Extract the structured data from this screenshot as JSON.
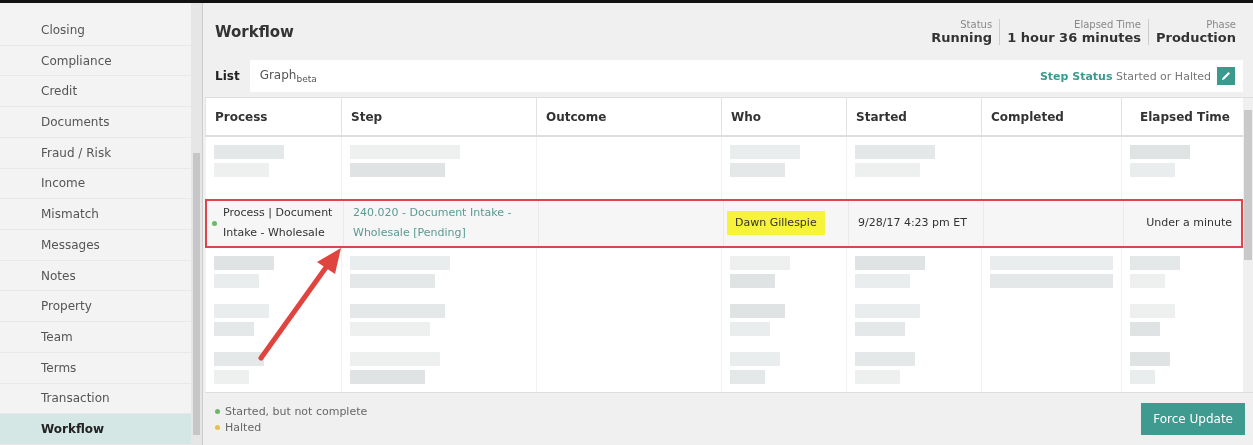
{
  "sidebar": {
    "items": [
      {
        "label": "Closing",
        "selected": false
      },
      {
        "label": "Compliance",
        "selected": false
      },
      {
        "label": "Credit",
        "selected": false
      },
      {
        "label": "Documents",
        "selected": false
      },
      {
        "label": "Fraud / Risk",
        "selected": false
      },
      {
        "label": "Income",
        "selected": false
      },
      {
        "label": "Mismatch",
        "selected": false
      },
      {
        "label": "Messages",
        "selected": false
      },
      {
        "label": "Notes",
        "selected": false
      },
      {
        "label": "Property",
        "selected": false
      },
      {
        "label": "Team",
        "selected": false
      },
      {
        "label": "Terms",
        "selected": false
      },
      {
        "label": "Transaction",
        "selected": false
      },
      {
        "label": "Workflow",
        "selected": true
      }
    ]
  },
  "header": {
    "title": "Workflow",
    "stats": [
      {
        "label": "Status",
        "value": "Running"
      },
      {
        "label": "Elapsed Time",
        "value": "1 hour 36 minutes"
      },
      {
        "label": "Phase",
        "value": "Production"
      }
    ]
  },
  "tabs": [
    {
      "label": "List",
      "selected": true
    },
    {
      "label": "Graph",
      "sub": "beta",
      "selected": false
    }
  ],
  "filter": {
    "label": "Step Status",
    "value": "Started or Halted"
  },
  "table": {
    "columns": [
      "Process",
      "Step",
      "Outcome",
      "Who",
      "Started",
      "Completed",
      "Elapsed Time"
    ],
    "rows": [
      {
        "kind": "redacted"
      },
      {
        "kind": "entry",
        "highlighted": true,
        "color": "#6cb86a",
        "process": "Process | Document Intake - Wholesale",
        "step": "240.020 - Document Intake - Wholesale [Pending]",
        "who": "Dawn Gillespie",
        "who_marked": true,
        "started": "9/28/17 4:23 pm ET",
        "elapsed": "Under a minute"
      },
      {
        "kind": "redacted"
      },
      {
        "kind": "redacted"
      },
      {
        "kind": "redacted"
      }
    ]
  },
  "legend": [
    {
      "label": "Started, but not complete",
      "color": "#6cb86a"
    },
    {
      "label": "Halted",
      "color": "#e8c14a"
    }
  ],
  "force_update": {
    "label": "Force Update"
  }
}
